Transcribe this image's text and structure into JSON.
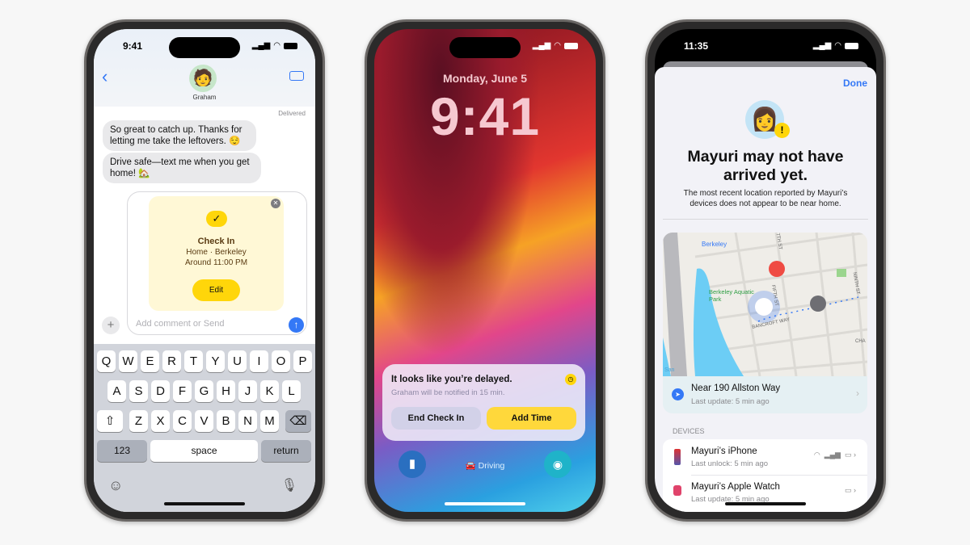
{
  "messages": {
    "time": "9:41",
    "contact": "Graham",
    "delivered": "Delivered",
    "bubbles": [
      "So great to catch up. Thanks for letting me take the leftovers. 😌",
      "Drive safe—text me when you get home! 🏡"
    ],
    "checkin": {
      "title": "Check In",
      "place": "Home · Berkeley",
      "time": "Around 11:00 PM",
      "edit": "Edit"
    },
    "input_placeholder": "Add comment or Send",
    "keyboard": {
      "row1": [
        "Q",
        "W",
        "E",
        "R",
        "T",
        "Y",
        "U",
        "I",
        "O",
        "P"
      ],
      "row2": [
        "A",
        "S",
        "D",
        "F",
        "G",
        "H",
        "J",
        "K",
        "L"
      ],
      "row3": [
        "Z",
        "X",
        "C",
        "V",
        "B",
        "N",
        "M"
      ],
      "num": "123",
      "space": "space",
      "return": "return"
    }
  },
  "lock": {
    "date": "Monday, June 5",
    "time": "9:41",
    "notification": {
      "title": "It looks like you’re delayed.",
      "body": "Graham will be notified in 15 min.",
      "end": "End Check In",
      "add": "Add Time"
    },
    "focus": "Driving"
  },
  "findmy": {
    "time": "11:35",
    "done": "Done",
    "title": "Mayuri may not have arrived yet.",
    "subtitle": "The most recent location reported by Mayuri’s devices does not appear to be near home.",
    "map": {
      "station": "Berkeley",
      "park": "Berkeley Aquatic Park",
      "street1": "BANCROFT WAY",
      "street2": "FIFTH ST",
      "street3": "NINTH ST",
      "street4": "7TH ST",
      "street5": "CHA",
      "bay": "San"
    },
    "location": {
      "name": "Near 190 Allston Way",
      "update": "Last update: 5 min ago"
    },
    "devices_header": "DEVICES",
    "devices": [
      {
        "name": "Mayuri’s iPhone",
        "detail": "Last unlock: 5 min ago"
      },
      {
        "name": "Mayuri’s Apple Watch",
        "detail": "Last update: 5 min ago"
      }
    ]
  },
  "colors": {
    "accent": "#3478f6",
    "checkin_yellow": "#ffd60a",
    "card_bg": "#fff8d6"
  }
}
